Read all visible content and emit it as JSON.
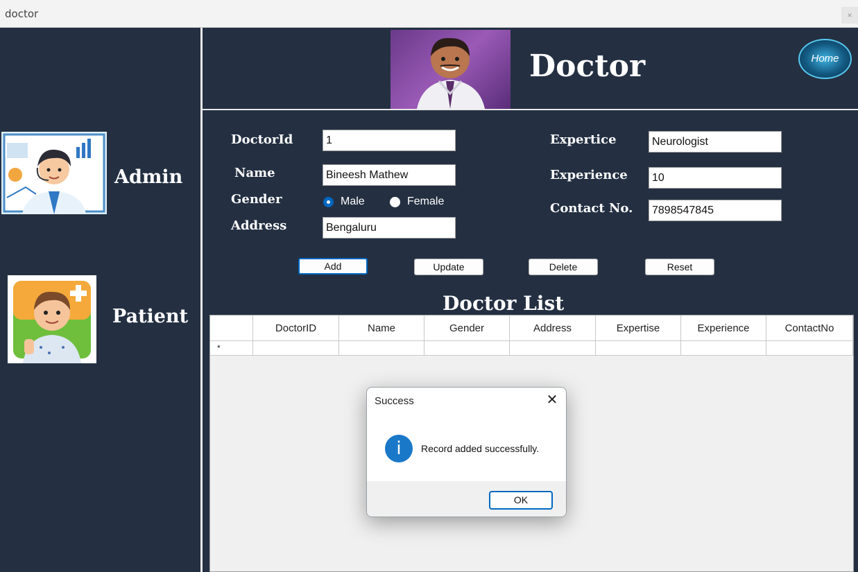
{
  "window": {
    "title": "doctor",
    "close_glyph": "×"
  },
  "sidebar": {
    "items": [
      {
        "label": "Admin",
        "icon": "admin-avatar-icon"
      },
      {
        "label": "Patient",
        "icon": "patient-avatar-icon"
      }
    ]
  },
  "header": {
    "title": "Doctor",
    "home_label": "Home",
    "image": "doctor-avatar"
  },
  "form": {
    "labels": {
      "doctor_id": "DoctorId",
      "name": "Name",
      "gender": "Gender",
      "address": "Address",
      "expertice": "Expertice",
      "experience": "Experience",
      "contact": "Contact No."
    },
    "values": {
      "doctor_id": "1",
      "name": "Bineesh Mathew",
      "address": "Bengaluru",
      "expertice": "Neurologist",
      "experience": "10",
      "contact": "7898547845"
    },
    "gender_options": [
      "Male",
      "Female"
    ],
    "gender_selected": "Male"
  },
  "buttons": {
    "add": "Add",
    "update": "Update",
    "delete": "Delete",
    "reset": "Reset"
  },
  "list": {
    "title": "Doctor List",
    "columns": [
      "DoctorID",
      "Name",
      "Gender",
      "Address",
      "Expertise",
      "Experience",
      "ContactNo"
    ],
    "new_row_marker": "*"
  },
  "dialog": {
    "title": "Success",
    "message": "Record added successfully.",
    "ok_label": "OK",
    "icon": "info-icon",
    "close_glyph": "✕"
  },
  "colors": {
    "background": "#243042",
    "accent": "#0067c0",
    "info": "#1a78c8"
  }
}
